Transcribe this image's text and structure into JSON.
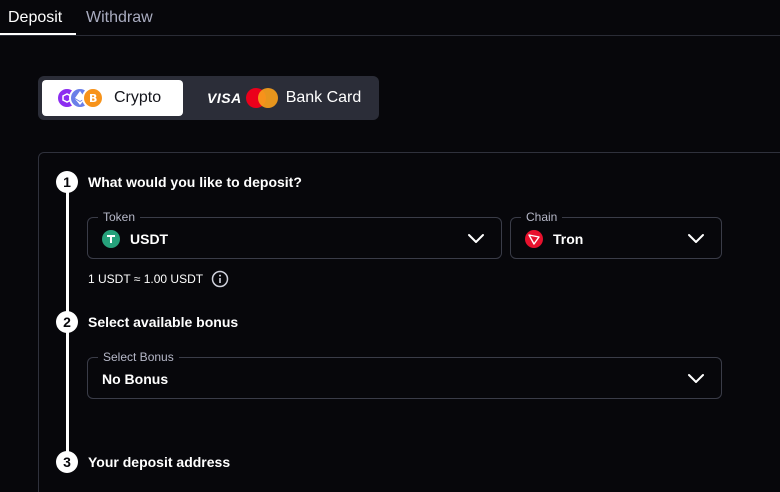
{
  "tabs": [
    {
      "label": "Deposit",
      "active": true
    },
    {
      "label": "Withdraw",
      "active": false
    }
  ],
  "methods": {
    "crypto": {
      "label": "Crypto",
      "selected": true,
      "icons": [
        "polygon-coin-icon",
        "ethereum-coin-icon",
        "bitcoin-coin-icon"
      ]
    },
    "card": {
      "label": "Bank Card",
      "selected": false,
      "visa_text": "VISA",
      "icons": [
        "visa-logo",
        "mastercard-logo"
      ]
    }
  },
  "steps": [
    {
      "number": "1",
      "title": "What would you like to deposit?"
    },
    {
      "number": "2",
      "title": "Select available bonus"
    },
    {
      "number": "3",
      "title": "Your deposit address"
    }
  ],
  "token": {
    "legend": "Token",
    "value": "USDT",
    "icon": "tether-icon"
  },
  "chain": {
    "legend": "Chain",
    "value": "Tron",
    "icon": "tron-icon"
  },
  "rate_text": "1 USDT ≈ 1.00 USDT",
  "bonus": {
    "legend": "Select Bonus",
    "value": "No Bonus"
  },
  "colors": {
    "background": "#07070b",
    "border": "#3a3c48",
    "tether": "#26a17b",
    "tron": "#e8112d",
    "bitcoin": "#f7931a"
  }
}
